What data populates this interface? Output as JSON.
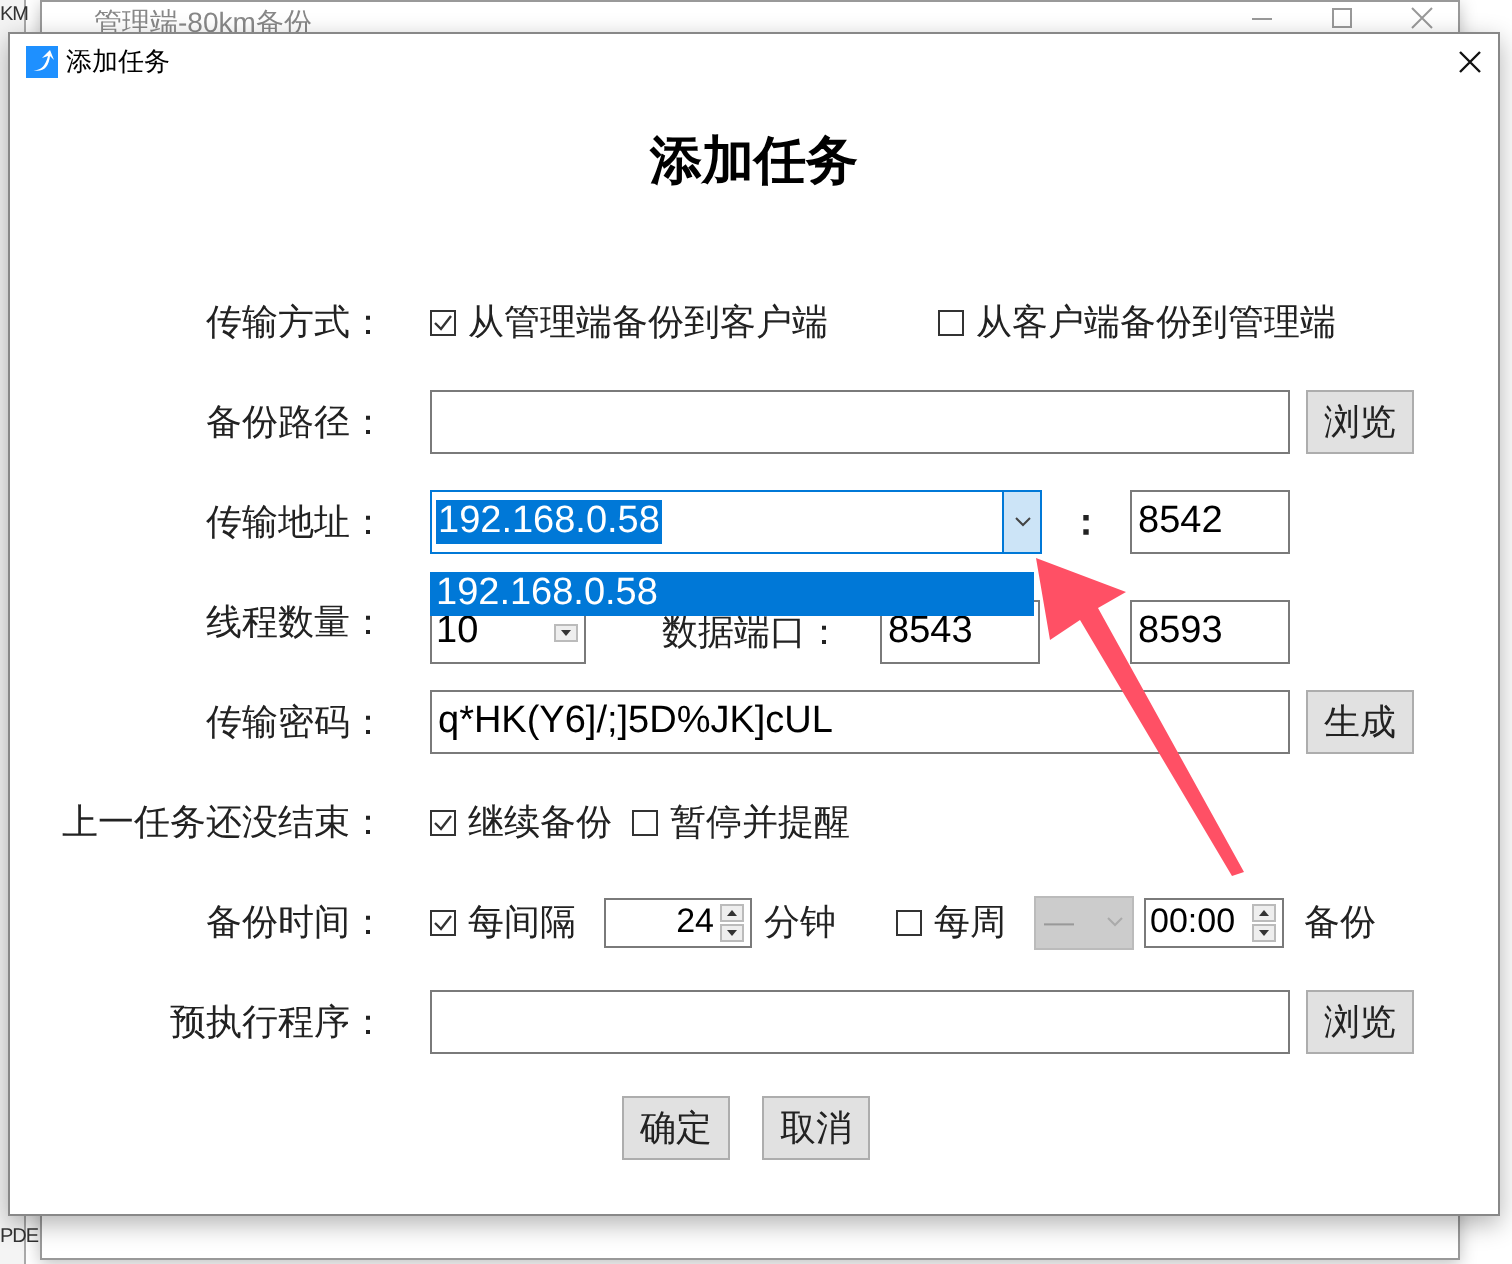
{
  "background_window": {
    "title": "管理端-80km备份",
    "fragments": [
      "KM",
      "PDE"
    ]
  },
  "dialog": {
    "title": "添加任务",
    "heading": "添加任务"
  },
  "transfer_mode": {
    "label": "传输方式：",
    "options": [
      {
        "label": "从管理端备份到客户端",
        "checked": true
      },
      {
        "label": "从客户端备份到管理端",
        "checked": false
      }
    ]
  },
  "backup_path": {
    "label": "备份路径：",
    "button": "浏览"
  },
  "address": {
    "label": "传输地址：",
    "value": "192.168.0.58",
    "expanded": true,
    "separator": "：",
    "port": "8542",
    "dropdown_items": [
      {
        "label": "192.168.0.58",
        "selected": true
      }
    ]
  },
  "threads": {
    "label": "线程数量：",
    "value": "10",
    "data_port_label": "数据端口：",
    "data_port": "8543",
    "port_2": "8593"
  },
  "password": {
    "label": "传输密码：",
    "value": "q*HK(Y6]/;]5D%JK]cUL",
    "button": "生成"
  },
  "previous_unfinished": {
    "label": "上一任务还没结束：",
    "options": [
      {
        "label": "继续备份",
        "checked": true
      },
      {
        "label": "暂停并提醒",
        "checked": false
      }
    ]
  },
  "schedule": {
    "label": "备份时间：",
    "interval": {
      "label": "每间隔",
      "checked": true,
      "value": "24",
      "unit": "分钟"
    },
    "weekly": {
      "label": "每周",
      "checked": false,
      "day": "—",
      "day_disabled": true,
      "time": "00:00"
    },
    "suffix": "备份"
  },
  "pre_program": {
    "label": "预执行程序：",
    "button": "浏览"
  },
  "buttons": [
    "确定",
    "取消"
  ]
}
